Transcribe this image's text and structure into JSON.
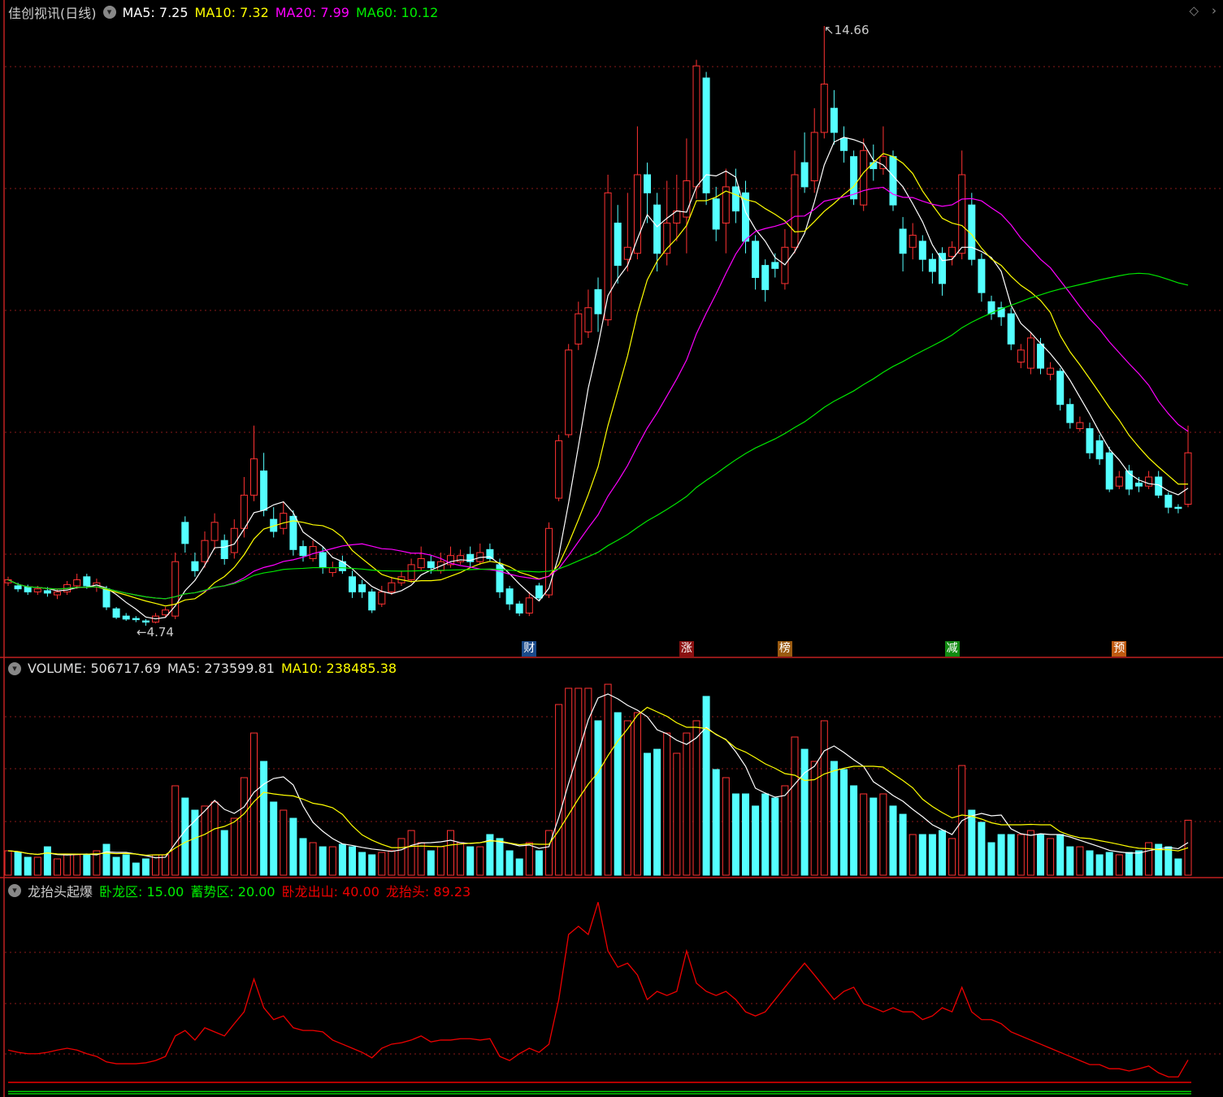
{
  "header": {
    "title": "佳创视讯(日线)",
    "ma5": "MA5: 7.25",
    "ma10": "MA10: 7.32",
    "ma20": "MA20: 7.99",
    "ma60": "MA60: 10.12"
  },
  "volume_header": {
    "volume": "VOLUME: 506717.69",
    "ma5": "MA5: 273599.81",
    "ma10": "MA10: 238485.38"
  },
  "indicator_header": {
    "name": "龙抬头起爆",
    "l1": "卧龙区: 15.00",
    "l2": "蓄势区: 20.00",
    "l3": "卧龙出山: 40.00",
    "l4": "龙抬头: 89.23"
  },
  "annotations": {
    "high": "14.66",
    "low": "4.74"
  },
  "markers": [
    {
      "label": "财",
      "color": "#1a4a8a",
      "index": 53
    },
    {
      "label": "涨",
      "color": "#8a1010",
      "index": 69
    },
    {
      "label": "榜",
      "color": "#9a5a10",
      "index": 79
    },
    {
      "label": "减",
      "color": "#118a11",
      "index": 96
    },
    {
      "label": "预",
      "color": "#c05a10",
      "index": 113
    }
  ],
  "colors": {
    "up": "#ff3232",
    "down": "#54ffff",
    "ma5": "#ffffff",
    "ma10": "#ffff00",
    "ma20": "#ff00ff",
    "ma60": "#00e600",
    "grid": "#8a1a1a"
  },
  "chart_data": [
    {
      "type": "candlestick",
      "title": "佳创视讯(日线)",
      "ylim": [
        4.5,
        14.9
      ],
      "fields": [
        "open",
        "close",
        "high",
        "low"
      ],
      "ohlc": [
        [
          5.45,
          5.5,
          5.55,
          5.4
        ],
        [
          5.4,
          5.35,
          5.45,
          5.3
        ],
        [
          5.38,
          5.3,
          5.42,
          5.25
        ],
        [
          5.3,
          5.35,
          5.4,
          5.25
        ],
        [
          5.32,
          5.28,
          5.38,
          5.22
        ],
        [
          5.25,
          5.3,
          5.35,
          5.18
        ],
        [
          5.3,
          5.42,
          5.48,
          5.25
        ],
        [
          5.4,
          5.5,
          5.6,
          5.35
        ],
        [
          5.55,
          5.4,
          5.6,
          5.35
        ],
        [
          5.38,
          5.45,
          5.52,
          5.3
        ],
        [
          5.35,
          5.05,
          5.4,
          5.0
        ],
        [
          5.02,
          4.88,
          5.05,
          4.85
        ],
        [
          4.9,
          4.85,
          4.95,
          4.82
        ],
        [
          4.86,
          4.84,
          4.9,
          4.8
        ],
        [
          4.82,
          4.8,
          4.85,
          4.74
        ],
        [
          4.8,
          4.9,
          4.95,
          4.78
        ],
        [
          4.92,
          5.0,
          5.05,
          4.88
        ],
        [
          4.9,
          5.8,
          5.95,
          4.85
        ],
        [
          6.45,
          6.1,
          6.55,
          5.95
        ],
        [
          5.8,
          5.65,
          5.95,
          5.55
        ],
        [
          5.8,
          6.15,
          6.3,
          5.7
        ],
        [
          6.15,
          6.45,
          6.6,
          6.0
        ],
        [
          6.15,
          5.85,
          6.25,
          5.75
        ],
        [
          5.95,
          6.35,
          6.5,
          5.85
        ],
        [
          6.35,
          6.9,
          7.2,
          6.2
        ],
        [
          6.9,
          7.5,
          8.05,
          6.8
        ],
        [
          7.3,
          6.65,
          7.6,
          6.55
        ],
        [
          6.5,
          6.3,
          6.7,
          6.2
        ],
        [
          6.35,
          6.6,
          6.8,
          6.25
        ],
        [
          6.55,
          6.0,
          6.65,
          5.9
        ],
        [
          6.05,
          5.9,
          6.15,
          5.8
        ],
        [
          5.85,
          6.05,
          6.15,
          5.8
        ],
        [
          5.95,
          5.7,
          6.05,
          5.6
        ],
        [
          5.62,
          5.7,
          5.8,
          5.55
        ],
        [
          5.8,
          5.65,
          5.9,
          5.6
        ],
        [
          5.55,
          5.3,
          5.65,
          5.2
        ],
        [
          5.42,
          5.3,
          5.5,
          5.2
        ],
        [
          5.3,
          5.0,
          5.35,
          4.95
        ],
        [
          5.1,
          5.3,
          5.4,
          5.05
        ],
        [
          5.3,
          5.45,
          5.55,
          5.25
        ],
        [
          5.45,
          5.55,
          5.65,
          5.4
        ],
        [
          5.5,
          5.75,
          5.85,
          5.45
        ],
        [
          5.7,
          5.85,
          6.05,
          5.65
        ],
        [
          5.8,
          5.7,
          5.9,
          5.6
        ],
        [
          5.65,
          5.8,
          5.95,
          5.6
        ],
        [
          5.75,
          5.9,
          6.05,
          5.7
        ],
        [
          5.8,
          5.9,
          6.0,
          5.75
        ],
        [
          5.92,
          5.8,
          6.05,
          5.7
        ],
        [
          5.8,
          5.95,
          6.1,
          5.75
        ],
        [
          6.0,
          5.85,
          6.1,
          5.8
        ],
        [
          5.75,
          5.3,
          5.85,
          5.2
        ],
        [
          5.35,
          5.1,
          5.4,
          5.0
        ],
        [
          5.1,
          4.95,
          5.15,
          4.9
        ],
        [
          4.95,
          5.2,
          5.3,
          4.9
        ],
        [
          5.4,
          5.2,
          5.45,
          5.15
        ],
        [
          5.25,
          6.35,
          6.45,
          5.2
        ],
        [
          6.85,
          7.8,
          7.9,
          6.8
        ],
        [
          7.9,
          9.3,
          9.4,
          7.85
        ],
        [
          9.4,
          9.9,
          10.1,
          9.3
        ],
        [
          9.6,
          10.0,
          10.3,
          9.5
        ],
        [
          10.3,
          9.9,
          10.5,
          9.6
        ],
        [
          9.8,
          11.9,
          12.2,
          9.7
        ],
        [
          11.4,
          10.7,
          11.7,
          10.4
        ],
        [
          10.8,
          11.0,
          11.9,
          10.6
        ],
        [
          10.9,
          12.2,
          13.0,
          10.8
        ],
        [
          12.2,
          11.9,
          12.4,
          11.4
        ],
        [
          11.7,
          10.9,
          11.9,
          10.6
        ],
        [
          10.9,
          11.4,
          12.1,
          10.7
        ],
        [
          11.4,
          11.6,
          12.2,
          11.1
        ],
        [
          11.5,
          12.1,
          12.8,
          10.9
        ],
        [
          12.0,
          14.0,
          14.1,
          11.8
        ],
        [
          13.8,
          11.9,
          13.9,
          11.7
        ],
        [
          11.8,
          11.3,
          12.0,
          11.1
        ],
        [
          11.4,
          12.0,
          12.3,
          10.9
        ],
        [
          12.0,
          11.6,
          12.3,
          11.4
        ],
        [
          11.9,
          11.1,
          12.1,
          10.9
        ],
        [
          11.1,
          10.5,
          11.2,
          10.3
        ],
        [
          10.7,
          10.3,
          10.8,
          10.1
        ],
        [
          10.75,
          10.65,
          10.9,
          10.5
        ],
        [
          10.4,
          11.0,
          11.3,
          10.3
        ],
        [
          11.0,
          12.2,
          12.6,
          10.9
        ],
        [
          12.4,
          12.0,
          12.9,
          11.9
        ],
        [
          12.1,
          12.9,
          13.3,
          11.9
        ],
        [
          12.9,
          13.7,
          14.66,
          12.8
        ],
        [
          13.3,
          12.9,
          13.6,
          12.7
        ],
        [
          12.8,
          12.6,
          13.0,
          12.4
        ],
        [
          12.5,
          11.8,
          12.6,
          11.7
        ],
        [
          11.7,
          12.6,
          12.8,
          11.6
        ],
        [
          12.4,
          12.3,
          12.7,
          12.1
        ],
        [
          12.3,
          12.5,
          13.0,
          12.2
        ],
        [
          12.5,
          11.7,
          12.6,
          11.6
        ],
        [
          11.3,
          10.9,
          11.5,
          10.6
        ],
        [
          11.0,
          11.2,
          11.4,
          10.8
        ],
        [
          11.1,
          10.8,
          11.2,
          10.6
        ],
        [
          10.8,
          10.6,
          10.9,
          10.4
        ],
        [
          10.9,
          10.4,
          11.0,
          10.2
        ],
        [
          10.85,
          11.0,
          11.1,
          10.7
        ],
        [
          10.9,
          12.2,
          12.6,
          10.8
        ],
        [
          11.7,
          10.8,
          11.9,
          10.7
        ],
        [
          10.8,
          10.25,
          10.9,
          10.1
        ],
        [
          10.1,
          9.9,
          10.2,
          9.8
        ],
        [
          10.0,
          9.85,
          10.1,
          9.7
        ],
        [
          9.9,
          9.4,
          10.0,
          9.3
        ],
        [
          9.1,
          9.3,
          9.4,
          9.0
        ],
        [
          9.0,
          9.5,
          9.6,
          8.9
        ],
        [
          9.4,
          9.0,
          9.5,
          8.9
        ],
        [
          8.9,
          9.0,
          9.1,
          8.8
        ],
        [
          8.95,
          8.4,
          9.0,
          8.3
        ],
        [
          8.4,
          8.1,
          8.5,
          8.0
        ],
        [
          8.0,
          8.1,
          8.2,
          7.95
        ],
        [
          8.0,
          7.6,
          8.1,
          7.5
        ],
        [
          7.8,
          7.5,
          7.9,
          7.4
        ],
        [
          7.6,
          7.0,
          7.7,
          6.95
        ],
        [
          7.05,
          7.2,
          7.3,
          7.0
        ],
        [
          7.3,
          7.0,
          7.4,
          6.9
        ],
        [
          7.1,
          7.05,
          7.2,
          6.95
        ],
        [
          7.05,
          7.2,
          7.3,
          7.0
        ],
        [
          7.2,
          6.9,
          7.3,
          6.85
        ],
        [
          6.9,
          6.7,
          6.95,
          6.6
        ],
        [
          6.7,
          6.68,
          6.75,
          6.6
        ],
        [
          6.75,
          7.6,
          8.05,
          6.7
        ]
      ],
      "moving_averages": [
        5,
        10,
        20,
        60
      ]
    },
    {
      "type": "bar",
      "title": "VOLUME",
      "unit": "thousand",
      "ylim": [
        0,
        1800
      ],
      "values": [
        225,
        210,
        165,
        165,
        262,
        150,
        188,
        188,
        188,
        225,
        285,
        165,
        188,
        112,
        150,
        188,
        188,
        825,
        712,
        600,
        638,
        675,
        412,
        525,
        900,
        1312,
        1050,
        675,
        600,
        525,
        338,
        300,
        262,
        262,
        285,
        262,
        210,
        188,
        210,
        225,
        338,
        412,
        300,
        225,
        262,
        412,
        300,
        262,
        262,
        375,
        338,
        225,
        150,
        300,
        225,
        412,
        1575,
        1725,
        1725,
        1725,
        1425,
        1762,
        1500,
        1425,
        1500,
        1125,
        1162,
        1312,
        1125,
        1312,
        1425,
        1650,
        975,
        900,
        750,
        750,
        638,
        750,
        712,
        825,
        1275,
        1162,
        1050,
        1425,
        1050,
        975,
        825,
        750,
        712,
        750,
        638,
        562,
        375,
        375,
        375,
        412,
        338,
        1012,
        600,
        488,
        300,
        375,
        375,
        375,
        412,
        375,
        338,
        375,
        262,
        262,
        225,
        188,
        210,
        188,
        210,
        225,
        300,
        285,
        262,
        150,
        507
      ],
      "moving_averages": [
        5,
        10
      ]
    },
    {
      "type": "line",
      "title": "龙抬头起爆",
      "ylim": [
        10,
        480
      ],
      "reference_lines": [
        15,
        20,
        40
      ],
      "values": [
        111,
        106,
        103,
        103,
        106,
        111,
        115,
        111,
        103,
        97,
        85,
        81,
        81,
        81,
        83,
        88,
        97,
        142,
        154,
        133,
        160,
        151,
        142,
        169,
        195,
        267,
        204,
        178,
        186,
        160,
        154,
        154,
        151,
        133,
        124,
        115,
        106,
        94,
        115,
        124,
        127,
        133,
        142,
        129,
        133,
        133,
        136,
        136,
        133,
        136,
        97,
        88,
        103,
        115,
        106,
        124,
        222,
        365,
        383,
        365,
        436,
        329,
        293,
        302,
        276,
        222,
        240,
        231,
        240,
        329,
        258,
        240,
        231,
        240,
        222,
        195,
        186,
        195,
        222,
        249,
        276,
        302,
        276,
        249,
        222,
        240,
        249,
        213,
        204,
        195,
        204,
        195,
        195,
        178,
        186,
        204,
        195,
        249,
        195,
        178,
        178,
        169,
        151,
        142,
        133,
        124,
        115,
        106,
        97,
        88,
        79,
        79,
        70,
        70,
        65,
        70,
        76,
        61,
        52,
        52,
        89.23
      ]
    }
  ]
}
